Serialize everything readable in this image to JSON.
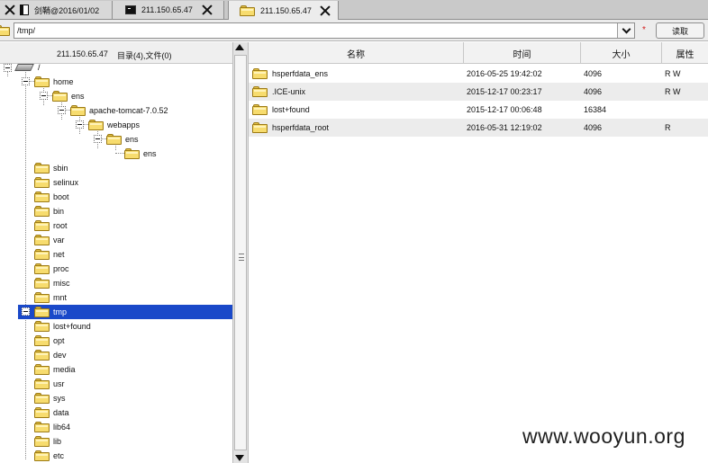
{
  "tabs": [
    {
      "title": "剑鞘@2016/01/02",
      "icon": "window-icon"
    },
    {
      "title": "211.150.65.47",
      "icon": "terminal-icon"
    },
    {
      "title": "211.150.65.47",
      "icon": "folder-icon"
    }
  ],
  "address": {
    "path": "/tmp/",
    "star": "*",
    "read_label": "读取"
  },
  "left": {
    "host": "211.150.65.47",
    "summary": "目录(4),文件(0)",
    "tree": {
      "root": "/",
      "home": "home",
      "ens": "ens",
      "tomcat": "apache-tomcat-7.0.52",
      "webapps": "webapps",
      "ens2": "ens",
      "ens3": "ens",
      "top": [
        "sbin",
        "selinux",
        "boot",
        "bin",
        "root",
        "var",
        "net",
        "proc",
        "misc",
        "mnt",
        "tmp",
        "lost+found",
        "opt",
        "dev",
        "media",
        "usr",
        "sys",
        "data",
        "lib64",
        "lib",
        "etc"
      ]
    }
  },
  "right": {
    "columns": {
      "name": "名称",
      "time": "时间",
      "size": "大小",
      "attr": "属性"
    },
    "files": [
      {
        "name": "hsperfdata_ens",
        "time": "2016-05-25 19:42:02",
        "size": "4096",
        "attr": "R W"
      },
      {
        "name": ".ICE-unix",
        "time": "2015-12-17 00:23:17",
        "size": "4096",
        "attr": "R W"
      },
      {
        "name": "lost+found",
        "time": "2015-12-17 00:06:48",
        "size": "16384",
        "attr": ""
      },
      {
        "name": "hsperfdata_root",
        "time": "2016-05-31 12:19:02",
        "size": "4096",
        "attr": "R"
      }
    ]
  },
  "watermark": "www.wooyun.org"
}
